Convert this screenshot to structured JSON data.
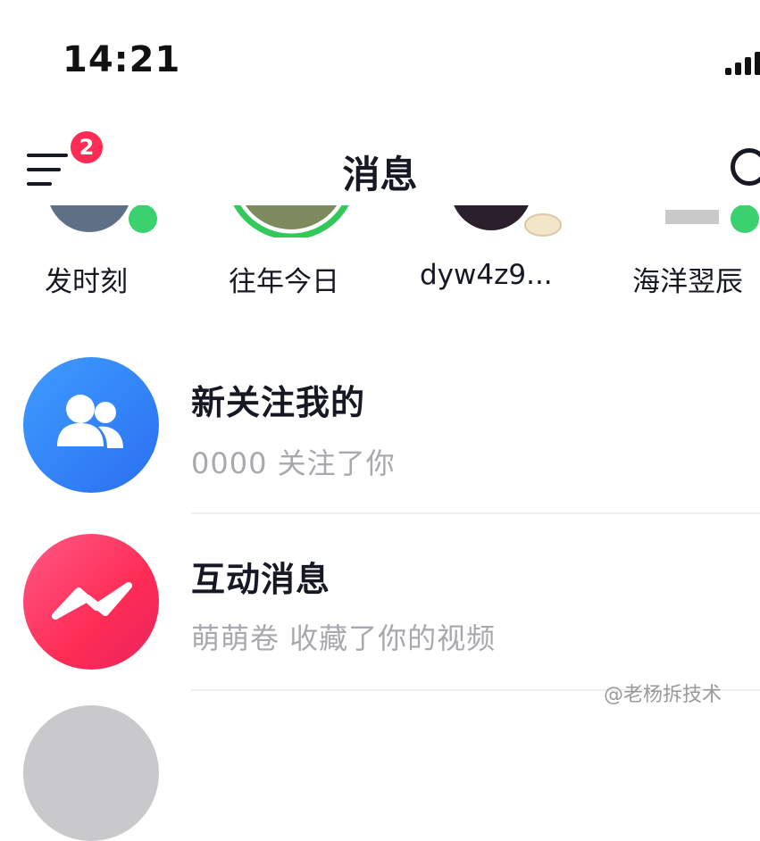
{
  "status_bar": {
    "time": "14:21"
  },
  "nav": {
    "title": "消息",
    "badge_count": "2"
  },
  "stories": [
    {
      "label": "发时刻"
    },
    {
      "label": "往年今日"
    },
    {
      "label": "dyw4z9..."
    },
    {
      "label": "海洋翌辰"
    }
  ],
  "messages": [
    {
      "title": "新关注我的",
      "subtitle": "0000 关注了你",
      "icon": "people-icon",
      "color": "#2f7bf5"
    },
    {
      "title": "互动消息",
      "subtitle": "萌萌卷 收藏了你的视频",
      "icon": "lightning-chat-icon",
      "color": "#fe2c55"
    }
  ],
  "watermark": "@老杨拆技术",
  "colors": {
    "accent": "#fe2c55",
    "blue": "#2f7bf5",
    "text": "#161823",
    "muted": "#a8a9ae"
  }
}
